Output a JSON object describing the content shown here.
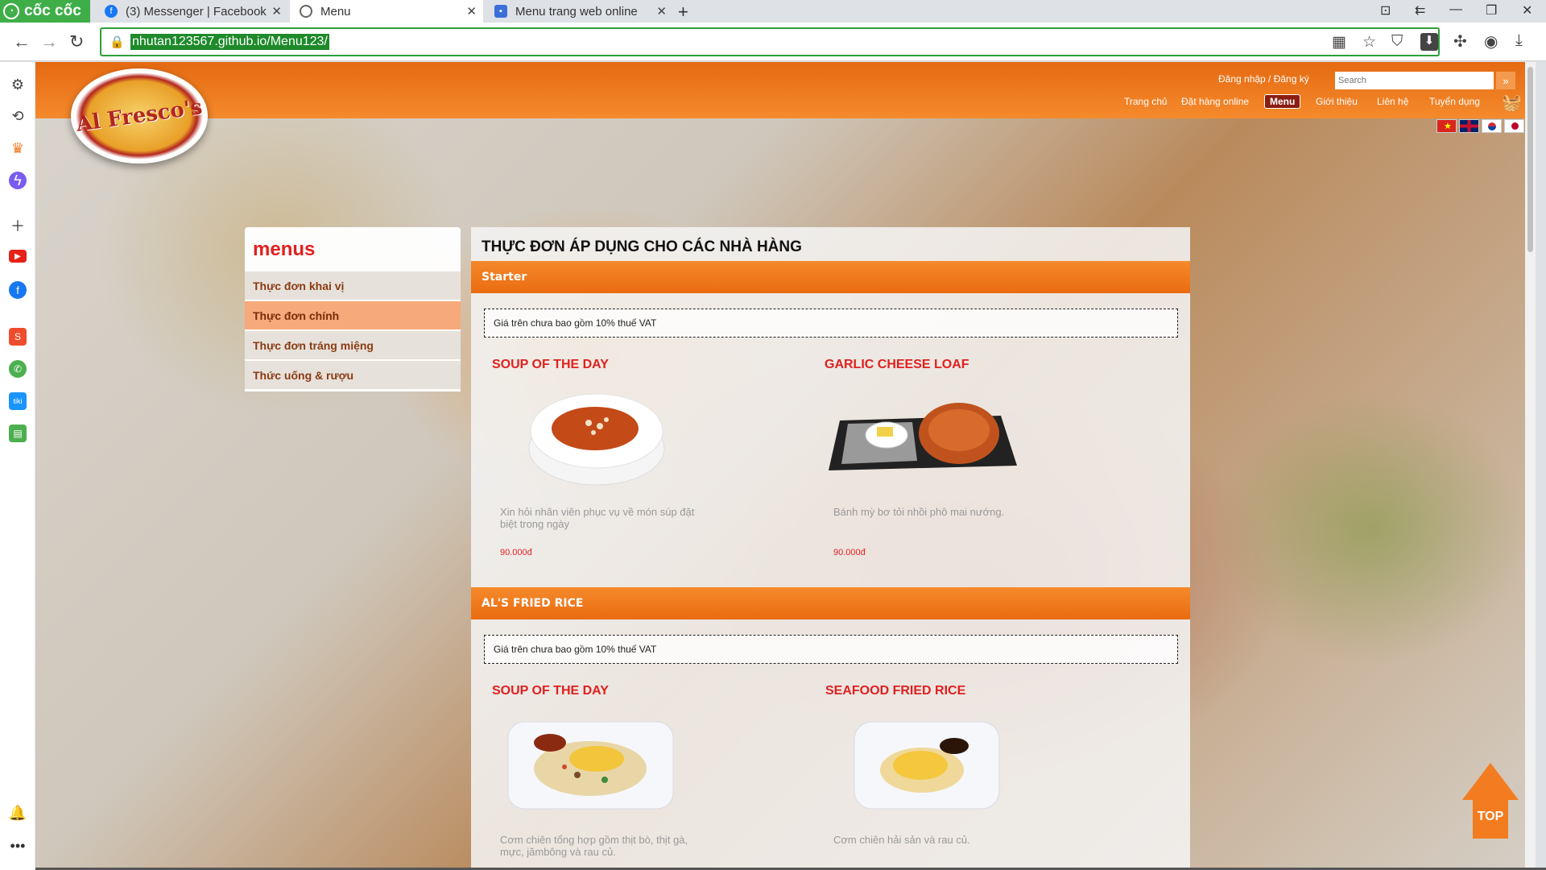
{
  "browser": {
    "brand": "cốc cốc",
    "tabs": [
      {
        "title": "(3) Messenger | Facebook",
        "icon": "facebook-icon"
      },
      {
        "title": "Menu",
        "icon": "globe-icon"
      },
      {
        "title": "Menu trang web online",
        "icon": "sites-icon"
      }
    ],
    "url": "nhutan123567.github.io/Menu123/"
  },
  "site": {
    "logo_text": "Al Fresco's",
    "auth_link": "Đăng nhập / Đăng ký",
    "search_placeholder": "Search",
    "nav": [
      "Trang chủ",
      "Đặt hàng online",
      "Menu",
      "Giới thiệu",
      "Liên hệ",
      "Tuyển dụng"
    ],
    "active_nav": "Menu",
    "flags": [
      "vietnam",
      "uk",
      "korea",
      "japan"
    ]
  },
  "menu_panel": {
    "title": "menus",
    "items": [
      "Thực đơn khai vị",
      "Thực đơn chính",
      "Thực đơn tráng miệng",
      "Thức uống & rượu"
    ],
    "active_item": "Thực đơn chính"
  },
  "content": {
    "heading": "THỰC ĐƠN ÁP DỤNG CHO CÁC NHÀ HÀNG",
    "sections": [
      {
        "name": "Starter",
        "vat_note": "Giá trên chưa bao gồm 10% thuế VAT",
        "items": [
          {
            "title": "SOUP OF THE DAY",
            "desc": "Xin hỏi nhân viên phục vụ về món súp đặt biệt trong ngày",
            "price": "90.000đ"
          },
          {
            "title": "GARLIC CHEESE LOAF",
            "desc": "Bánh mỳ bơ tỏi nhồi phô mai nướng.",
            "price": "90.000đ"
          }
        ]
      },
      {
        "name": "AL'S FRIED RICE",
        "vat_note": "Giá trên chưa bao gồm 10% thuế VAT",
        "items": [
          {
            "title": "SOUP OF THE DAY",
            "desc": "Cơm chiên tổng hợp gồm thịt bò, thịt gà, mực, jămbông và rau củ."
          },
          {
            "title": "SEAFOOD FRIED RICE",
            "desc": "Cơm chiên hải sản và rau củ."
          }
        ]
      }
    ]
  },
  "top_button": "TOP",
  "colors": {
    "header_orange": "#f07a20",
    "accent_red": "#e02020",
    "browser_green": "#3fae49"
  }
}
